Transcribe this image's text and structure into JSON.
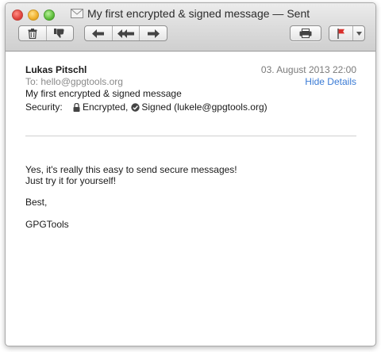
{
  "window": {
    "title": "My first encrypted & signed message — Sent"
  },
  "toolbar": {
    "delete_icon": "trash-icon",
    "junk_icon": "thumbs-down-icon",
    "reply_icon": "reply-arrow-icon",
    "reply_all_icon": "reply-all-arrow-icon",
    "forward_icon": "forward-arrow-icon",
    "print_icon": "printer-icon",
    "flag_icon": "flag-icon",
    "flag_color": "#d9302c"
  },
  "header": {
    "from_name": "Lukas Pitschl",
    "date": "03. August 2013 22:00",
    "to_label": "To:",
    "to_value": "hello@gpgtools.org",
    "hide_details": "Hide Details",
    "subject": "My first encrypted & signed message",
    "security_label": "Security:",
    "encrypted_text": "Encrypted,",
    "signed_text": "Signed (lukele@gpgtools.org)"
  },
  "body": {
    "line1": "Yes, it's really this easy to send secure messages!",
    "line2": "Just try it for yourself!",
    "line3": "Best,",
    "line4": "GPGTools"
  },
  "colors": {
    "link": "#3a7bd5",
    "muted": "#7a7a7a"
  }
}
